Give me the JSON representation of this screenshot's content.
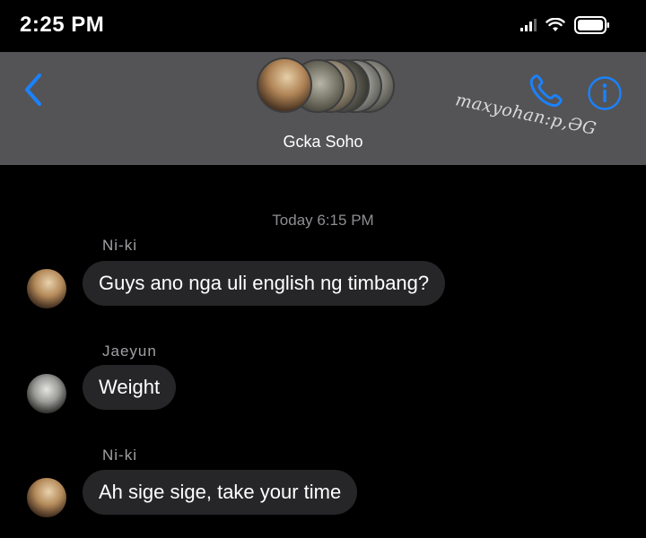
{
  "status_bar": {
    "time": "2:25 PM",
    "icons": [
      "signal-icon",
      "wifi-icon",
      "battery-icon"
    ]
  },
  "header": {
    "group_name": "Gcka Soho",
    "watermark": "maxyohan:p,ƏG",
    "icons": [
      "chevron-left-icon",
      "phone-icon",
      "info-icon"
    ],
    "accent_color": "#1a82ff",
    "background_color": "#545456"
  },
  "conversation": {
    "timestamp": "Today 6:15 PM",
    "messages": [
      {
        "sender": "Ni-ki",
        "text": "Guys ano nga uli english ng timbang?"
      },
      {
        "sender": "Jaeyun",
        "text": "Weight"
      },
      {
        "sender": "Ni-ki",
        "text": "Ah sige sige, take your time"
      }
    ]
  },
  "colors": {
    "bubble": "#262628",
    "meta_text": "#8e8e93"
  }
}
